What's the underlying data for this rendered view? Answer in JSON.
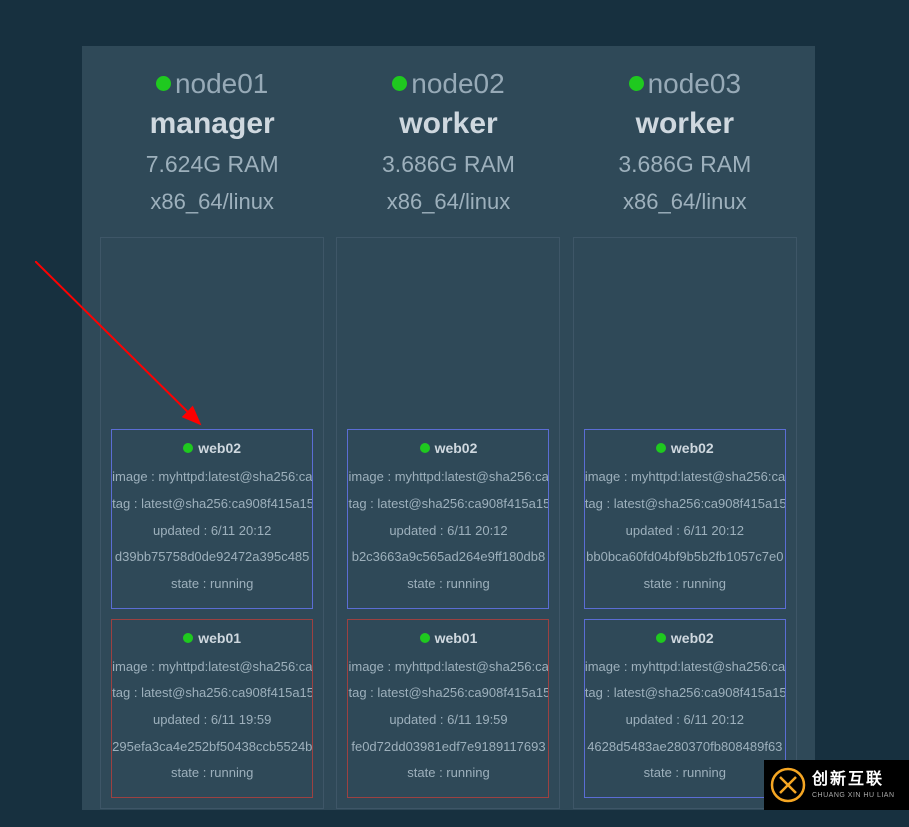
{
  "nodes": [
    {
      "name": "node01",
      "role": "manager",
      "ram": "7.624G RAM",
      "arch": "x86_64/linux",
      "containers": [
        {
          "name": "web02",
          "border": "blue",
          "image": "image : myhttpd:latest@sha256:ca",
          "tag": "tag : latest@sha256:ca908f415a15",
          "updated": "updated : 6/11 20:12",
          "hash": "d39bb75758d0de92472a395c485",
          "state": "state : running"
        },
        {
          "name": "web01",
          "border": "red",
          "image": "image : myhttpd:latest@sha256:ca",
          "tag": "tag : latest@sha256:ca908f415a15",
          "updated": "updated : 6/11 19:59",
          "hash": "295efa3ca4e252bf50438ccb5524b",
          "state": "state : running"
        }
      ]
    },
    {
      "name": "node02",
      "role": "worker",
      "ram": "3.686G RAM",
      "arch": "x86_64/linux",
      "containers": [
        {
          "name": "web02",
          "border": "blue",
          "image": "image : myhttpd:latest@sha256:ca",
          "tag": "tag : latest@sha256:ca908f415a15",
          "updated": "updated : 6/11 20:12",
          "hash": "b2c3663a9c565ad264e9ff180db8",
          "state": "state : running"
        },
        {
          "name": "web01",
          "border": "red",
          "image": "image : myhttpd:latest@sha256:ca",
          "tag": "tag : latest@sha256:ca908f415a15",
          "updated": "updated : 6/11 19:59",
          "hash": "fe0d72dd03981edf7e9189117693",
          "state": "state : running"
        }
      ]
    },
    {
      "name": "node03",
      "role": "worker",
      "ram": "3.686G RAM",
      "arch": "x86_64/linux",
      "containers": [
        {
          "name": "web02",
          "border": "blue",
          "image": "image : myhttpd:latest@sha256:ca",
          "tag": "tag : latest@sha256:ca908f415a15",
          "updated": "updated : 6/11 20:12",
          "hash": "bb0bca60fd04bf9b5b2fb1057c7e0",
          "state": "state : running"
        },
        {
          "name": "web02",
          "border": "blue",
          "image": "image : myhttpd:latest@sha256:ca",
          "tag": "tag : latest@sha256:ca908f415a15",
          "updated": "updated : 6/11 20:12",
          "hash": "4628d5483ae280370fb808489f63",
          "state": "state : running"
        }
      ]
    }
  ],
  "watermark": {
    "cn": "创新互联",
    "en": "CHUANG XIN HU LIAN"
  }
}
